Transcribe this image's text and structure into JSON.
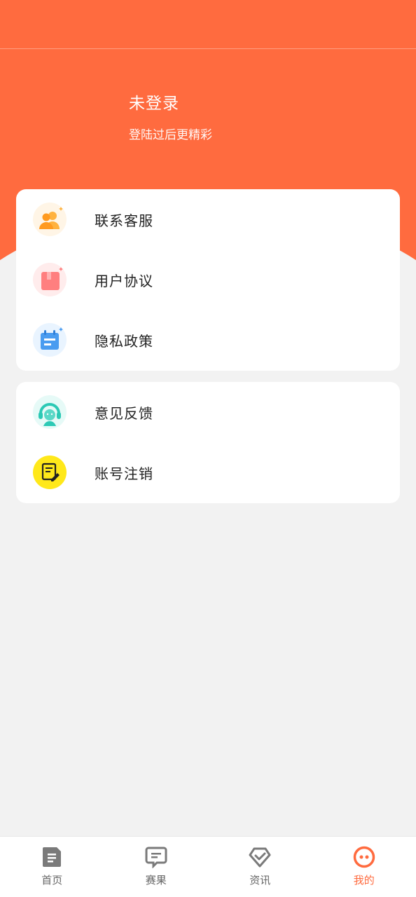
{
  "profile": {
    "title": "未登录",
    "subtitle": "登陆过后更精彩"
  },
  "menu_group_1": [
    {
      "label": "联系客服",
      "icon": "customer-service-icon"
    },
    {
      "label": "用户协议",
      "icon": "user-agreement-icon"
    },
    {
      "label": "隐私政策",
      "icon": "privacy-policy-icon"
    }
  ],
  "menu_group_2": [
    {
      "label": "意见反馈",
      "icon": "feedback-icon"
    },
    {
      "label": "账号注销",
      "icon": "account-cancel-icon"
    }
  ],
  "tabs": [
    {
      "label": "首页",
      "icon": "home-icon",
      "active": false
    },
    {
      "label": "赛果",
      "icon": "results-icon",
      "active": false
    },
    {
      "label": "资讯",
      "icon": "news-icon",
      "active": false
    },
    {
      "label": "我的",
      "icon": "mine-icon",
      "active": true
    }
  ],
  "colors": {
    "accent": "#ff6b3f",
    "background": "#f2f2f2",
    "tab_inactive": "#666666"
  }
}
